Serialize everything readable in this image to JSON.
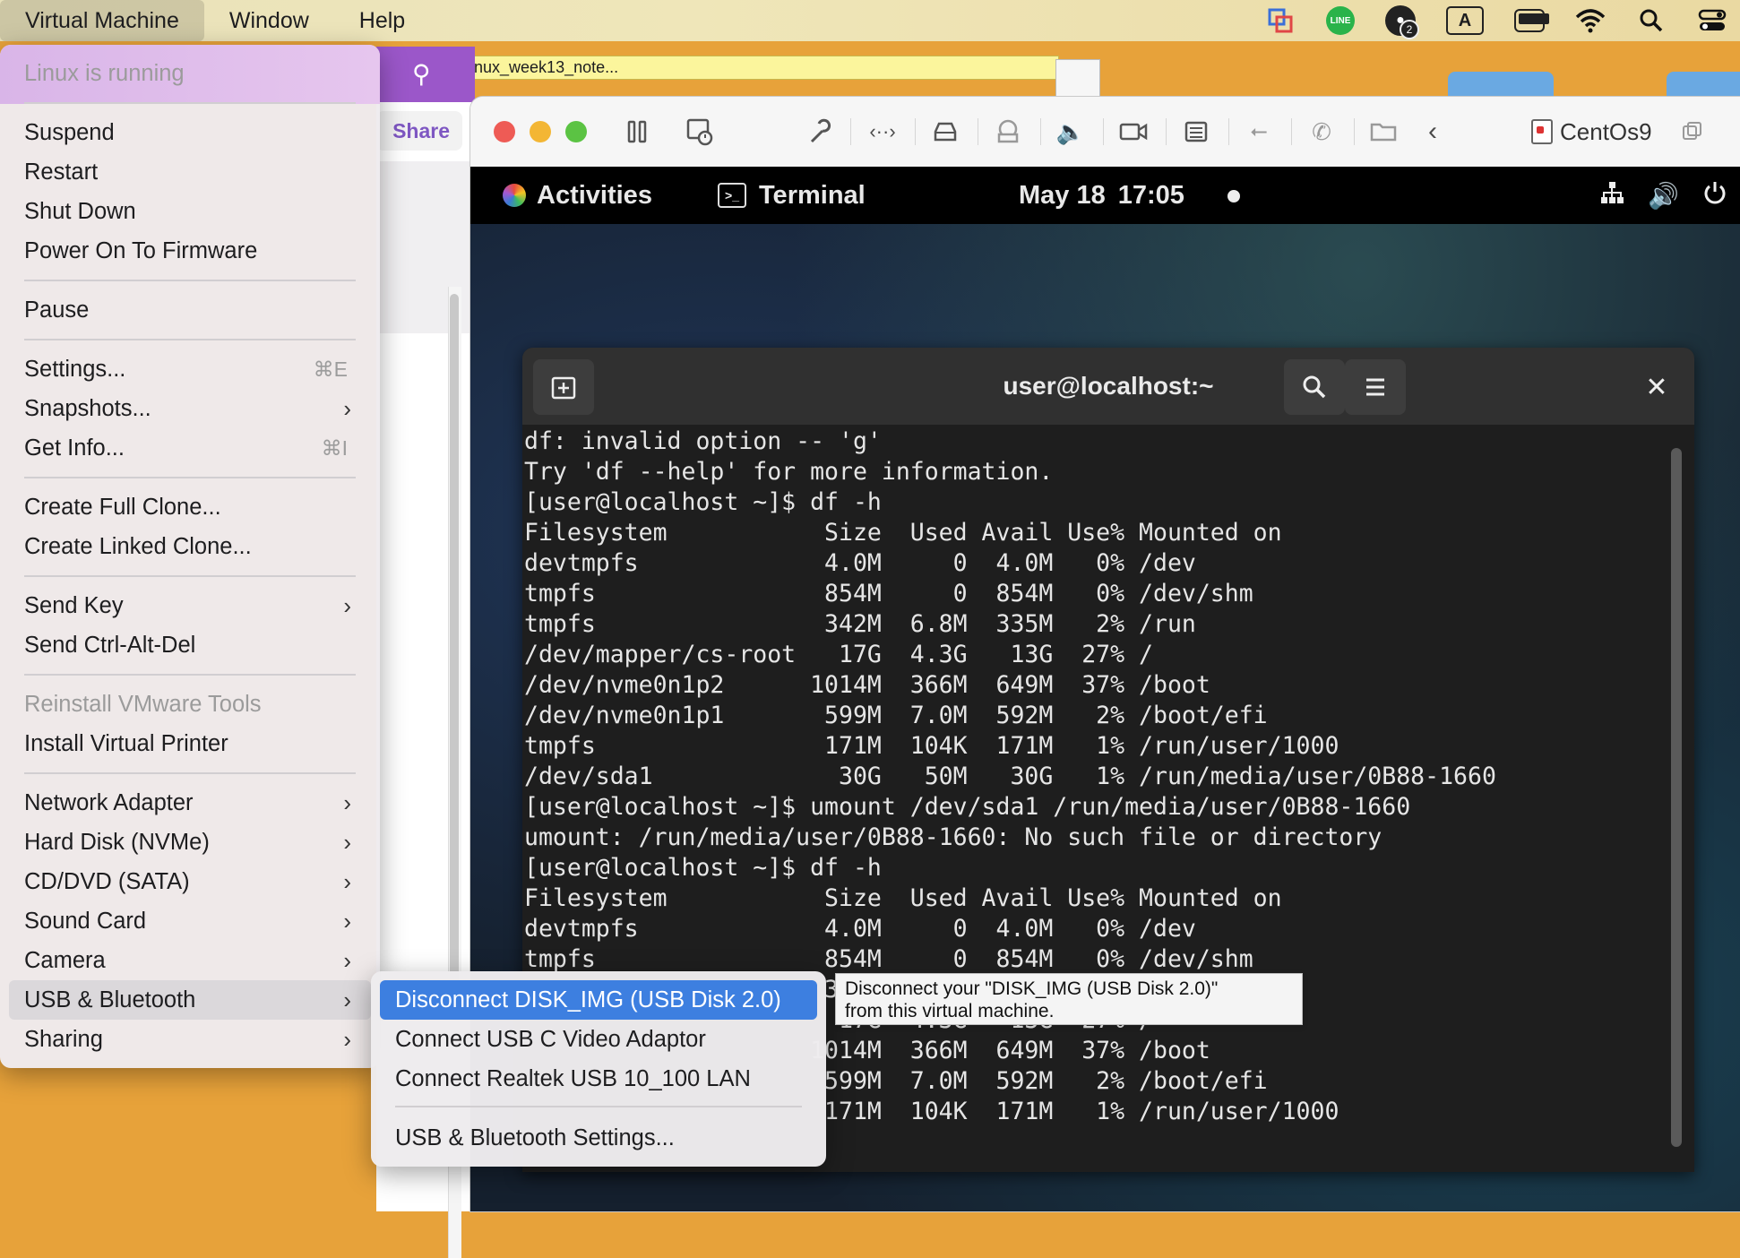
{
  "menubar": {
    "items": [
      "Virtual Machine",
      "Window",
      "Help"
    ],
    "status_icons": [
      "vmware-fusion-icon",
      "line-icon",
      "notification-icon",
      "input-source-icon",
      "battery-icon",
      "wifi-icon",
      "search-icon",
      "control-center-icon"
    ],
    "line_label": "LINE",
    "notification_count": "2",
    "input_source": "A"
  },
  "desktop": {
    "note_label": "inux_week13_note..."
  },
  "background_app": {
    "share_label": "Share"
  },
  "vm_window": {
    "name": "CentOs9",
    "toolbar_icons": [
      "pause-icon",
      "snapshot-icon",
      "settings-wrench-icon",
      "network-icon",
      "hard-disk-icon",
      "printer-icon",
      "sound-icon",
      "camera-icon",
      "display-icon",
      "usb-icon",
      "phone-icon",
      "shared-folders-icon",
      "back-icon"
    ]
  },
  "gnome": {
    "activities": "Activities",
    "app_name": "Terminal",
    "date": "May 18",
    "time": "17:05"
  },
  "terminal": {
    "title": "user@localhost:~",
    "lines": [
      "df: invalid option -- 'g'",
      "Try 'df --help' for more information.",
      "[user@localhost ~]$ df -h",
      "Filesystem           Size  Used Avail Use% Mounted on",
      "devtmpfs             4.0M     0  4.0M   0% /dev",
      "tmpfs                854M     0  854M   0% /dev/shm",
      "tmpfs                342M  6.8M  335M   2% /run",
      "/dev/mapper/cs-root   17G  4.3G   13G  27% /",
      "/dev/nvme0n1p2      1014M  366M  649M  37% /boot",
      "/dev/nvme0n1p1       599M  7.0M  592M   2% /boot/efi",
      "tmpfs                171M  104K  171M   1% /run/user/1000",
      "/dev/sda1             30G   50M   30G   1% /run/media/user/0B88-1660",
      "[user@localhost ~]$ umount /dev/sda1 /run/media/user/0B88-1660",
      "umount: /run/media/user/0B88-1660: No such file or directory",
      "[user@localhost ~]$ df -h",
      "Filesystem           Size  Used Avail Use% Mounted on",
      "devtmpfs             4.0M     0  4.0M   0% /dev",
      "tmpfs                854M     0  854M   0% /dev/shm",
      "                     342M  6.8M  335M   2% /run",
      "                      17G  4.3G   13G  27% /",
      "                    1014M  366M  649M  37% /boot",
      "                     599M  7.0M  592M   2% /boot/efi",
      "                     171M  104K  171M   1% /run/user/1000"
    ]
  },
  "vm_menu": {
    "status": "Linux is running",
    "items": [
      {
        "label": "Suspend"
      },
      {
        "label": "Restart"
      },
      {
        "label": "Shut Down"
      },
      {
        "label": "Power On To Firmware"
      },
      {
        "label": "Pause"
      },
      {
        "label": "Settings...",
        "shortcut": "⌘E"
      },
      {
        "label": "Snapshots..."
      },
      {
        "label": "Get Info...",
        "shortcut": "⌘I"
      },
      {
        "label": "Create Full Clone..."
      },
      {
        "label": "Create Linked Clone..."
      },
      {
        "label": "Send Key"
      },
      {
        "label": "Send Ctrl-Alt-Del"
      },
      {
        "label": "Reinstall VMware Tools"
      },
      {
        "label": "Install Virtual Printer"
      },
      {
        "label": "Network Adapter"
      },
      {
        "label": "Hard Disk (NVMe)"
      },
      {
        "label": "CD/DVD (SATA)"
      },
      {
        "label": "Sound Card"
      },
      {
        "label": "Camera"
      },
      {
        "label": "USB & Bluetooth"
      },
      {
        "label": "Sharing"
      }
    ]
  },
  "usb_submenu": {
    "items": [
      {
        "label": "Disconnect DISK_IMG (USB Disk 2.0)"
      },
      {
        "label": "Connect USB C Video Adaptor"
      },
      {
        "label": "Connect Realtek USB 10_100 LAN"
      },
      {
        "label": "USB & Bluetooth Settings..."
      }
    ],
    "tooltip_line1": "Disconnect your \"DISK_IMG (USB Disk 2.0)\"",
    "tooltip_line2": "from this virtual machine."
  }
}
